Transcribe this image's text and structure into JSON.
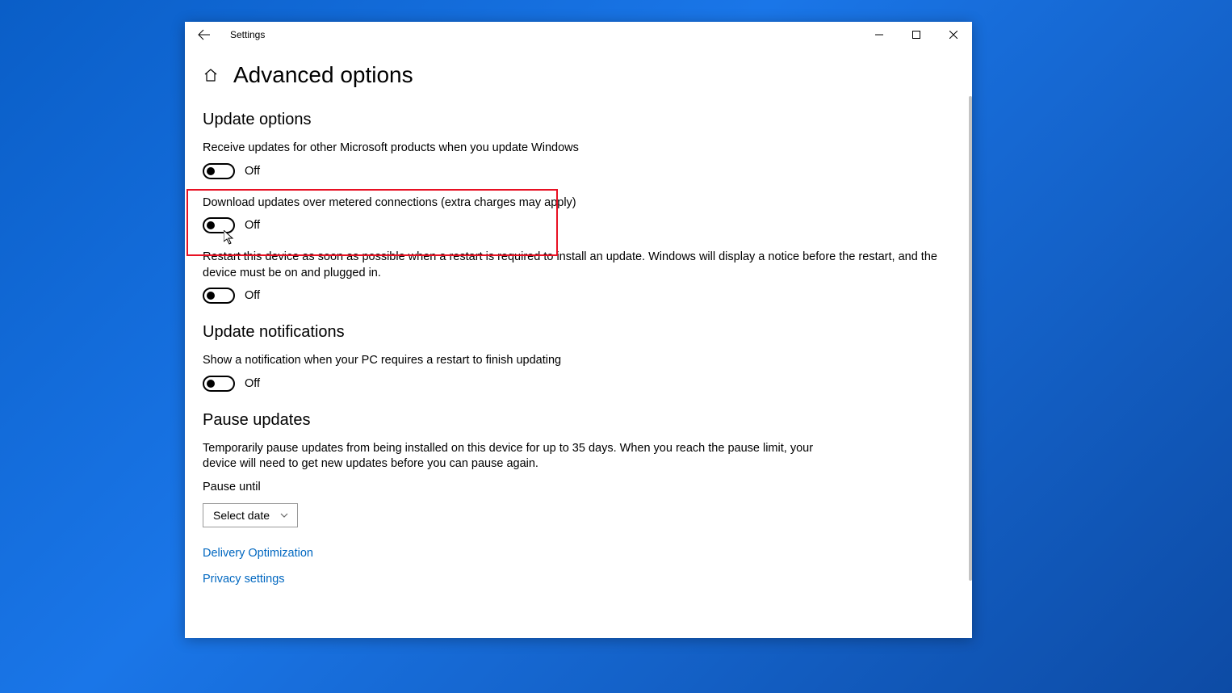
{
  "titlebar": {
    "app_title": "Settings"
  },
  "page": {
    "title": "Advanced options"
  },
  "sections": {
    "update_options": {
      "heading": "Update options",
      "opt1_label": "Receive updates for other Microsoft products when you update Windows",
      "opt1_state": "Off",
      "opt2_label": "Download updates over metered connections (extra charges may apply)",
      "opt2_state": "Off",
      "opt3_label": "Restart this device as soon as possible when a restart is required to install an update. Windows will display a notice before the restart, and the device must be on and plugged in.",
      "opt3_state": "Off"
    },
    "update_notifications": {
      "heading": "Update notifications",
      "opt1_label": "Show a notification when your PC requires a restart to finish updating",
      "opt1_state": "Off"
    },
    "pause_updates": {
      "heading": "Pause updates",
      "description": "Temporarily pause updates from being installed on this device for up to 35 days. When you reach the pause limit, your device will need to get new updates before you can pause again.",
      "sub_label": "Pause until",
      "dropdown_value": "Select date"
    }
  },
  "links": {
    "delivery": "Delivery Optimization",
    "privacy": "Privacy settings"
  }
}
